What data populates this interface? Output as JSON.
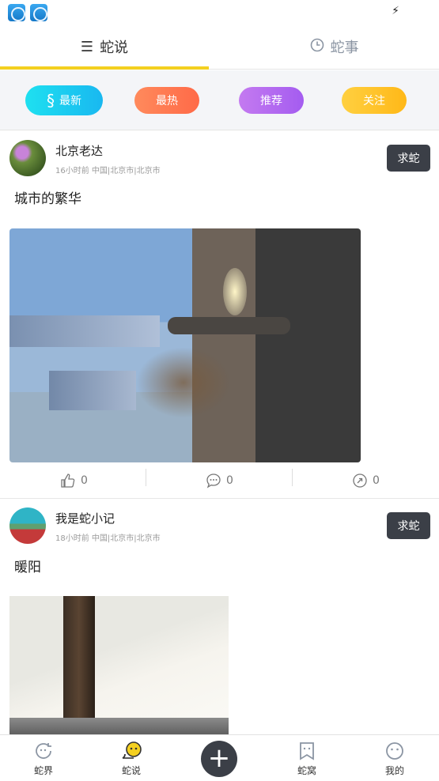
{
  "status_bar": {
    "app_icons": [
      "app-icon",
      "app-icon"
    ],
    "charging_icon": "bolt-icon"
  },
  "top_tabs": [
    {
      "label": "蛇说",
      "icon": "list-icon",
      "active": true
    },
    {
      "label": "蛇事",
      "icon": "clock-icon",
      "active": false
    }
  ],
  "filters": [
    {
      "label": "最新",
      "icon": "snake-logo-icon",
      "color": "#19b8f0",
      "selected": true
    },
    {
      "label": "最热",
      "color": "#ff6a48"
    },
    {
      "label": "推荐",
      "color": "#a45cf0"
    },
    {
      "label": "关注",
      "color": "#ffb818"
    }
  ],
  "posts": [
    {
      "author": "北京老达",
      "meta": "16小时前 中国|北京市|北京市",
      "ask_button": "求蛇",
      "text": "城市的繁华",
      "likes": "0",
      "comments": "0",
      "shares": "0"
    },
    {
      "author": "我是蛇小记",
      "meta": "18小时前 中国|北京市|北京市",
      "ask_button": "求蛇",
      "text": "暖阳"
    }
  ],
  "bottom_nav": [
    {
      "label": "蛇界",
      "icon": "refresh-face-icon"
    },
    {
      "label": "蛇说",
      "icon": "chat-face-icon",
      "active": true
    },
    {
      "label": "",
      "icon": "plus-icon"
    },
    {
      "label": "蛇窝",
      "icon": "bookmark-icon"
    },
    {
      "label": "我的",
      "icon": "face-icon"
    }
  ]
}
